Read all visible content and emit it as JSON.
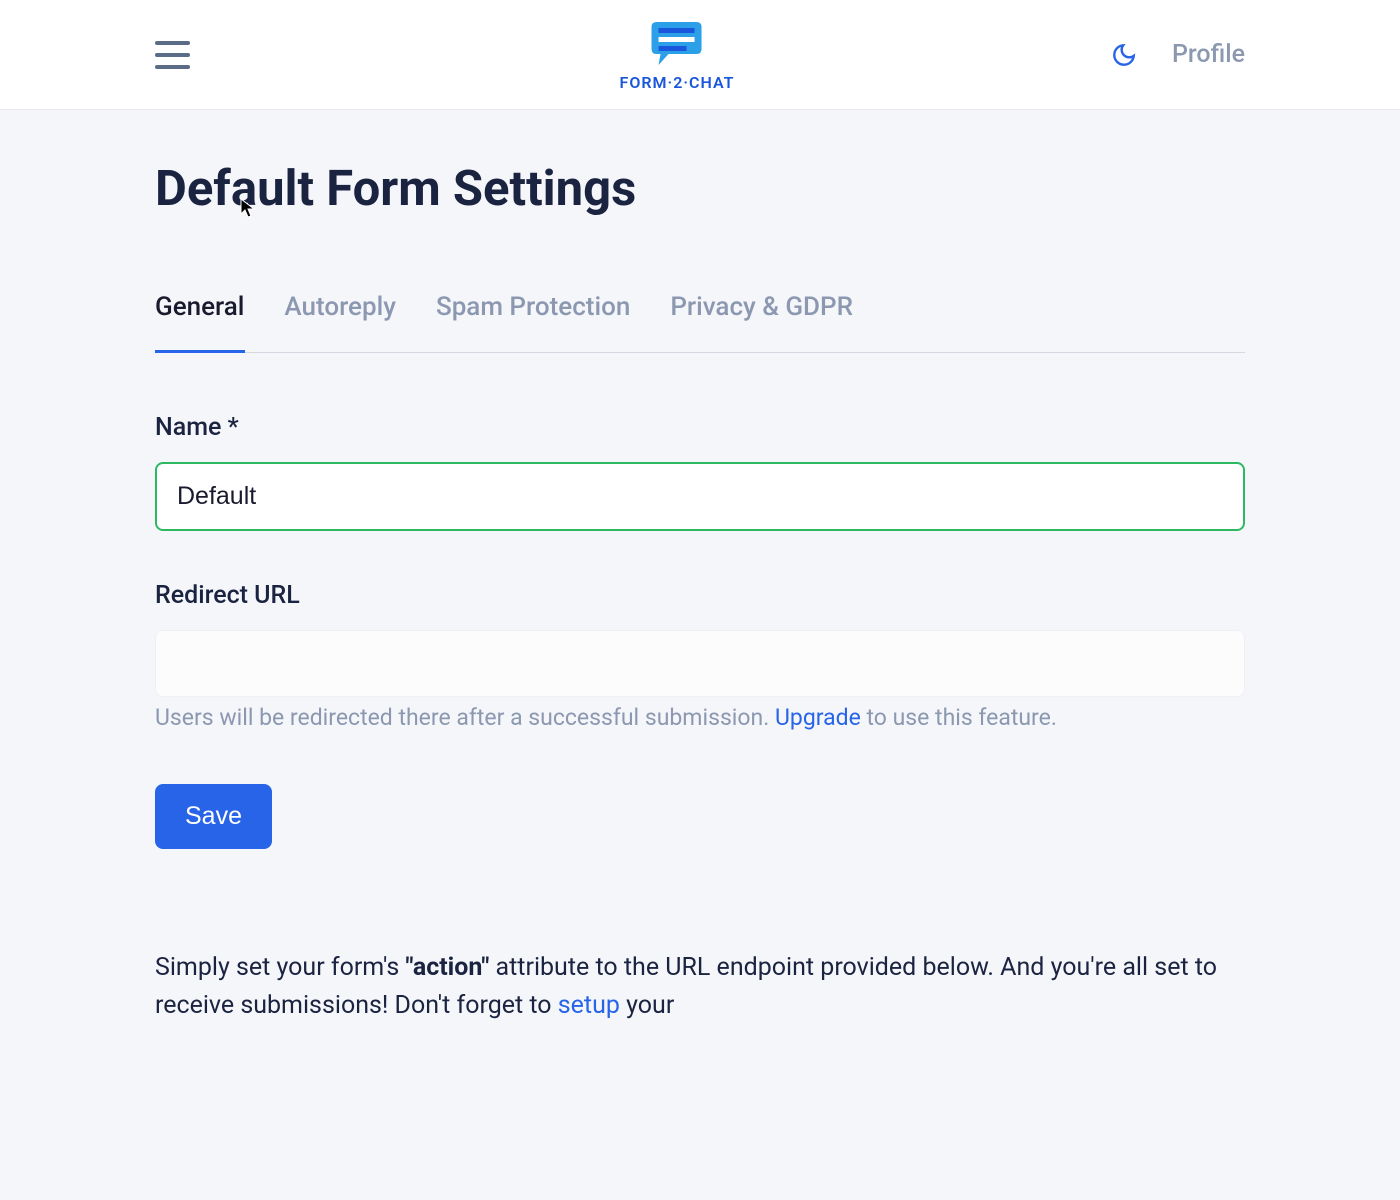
{
  "header": {
    "logo_text": "FORM·2·CHAT",
    "profile_label": "Profile"
  },
  "page": {
    "title": "Default Form Settings"
  },
  "tabs": [
    {
      "label": "General",
      "active": true
    },
    {
      "label": "Autoreply",
      "active": false
    },
    {
      "label": "Spam Protection",
      "active": false
    },
    {
      "label": "Privacy & GDPR",
      "active": false
    }
  ],
  "form": {
    "name_label": "Name *",
    "name_value": "Default",
    "redirect_label": "Redirect URL",
    "redirect_value": "",
    "redirect_help_prefix": "Users will be redirected there after a successful submission. ",
    "redirect_upgrade_link": "Upgrade",
    "redirect_help_suffix": " to use this feature.",
    "save_label": "Save"
  },
  "info": {
    "text_1": "Simply set your form's ",
    "action_word": "\"action\"",
    "text_2": " attribute to the URL endpoint provided below. And you're all set to receive submissions! Don't forget to ",
    "setup_link": "setup",
    "text_3": " your"
  }
}
